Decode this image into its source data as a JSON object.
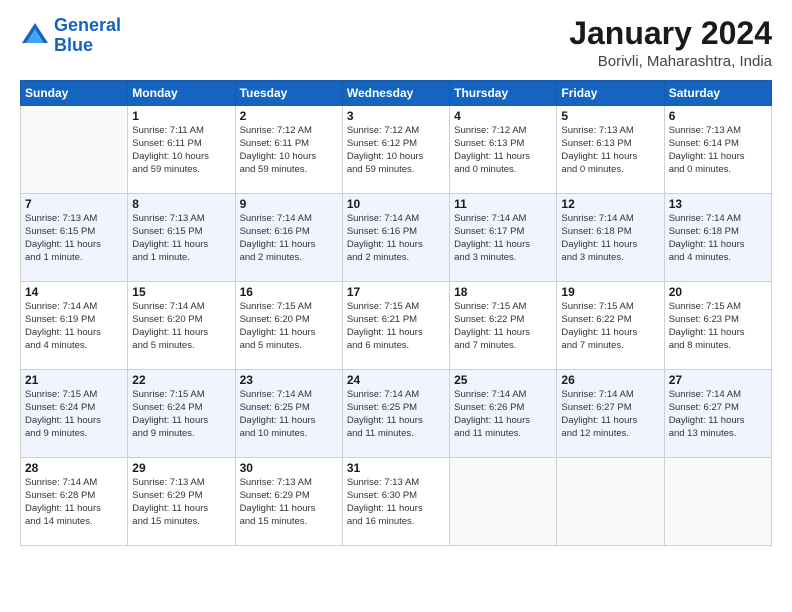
{
  "header": {
    "logo_line1": "General",
    "logo_line2": "Blue",
    "title": "January 2024",
    "subtitle": "Borivli, Maharashtra, India"
  },
  "days_of_week": [
    "Sunday",
    "Monday",
    "Tuesday",
    "Wednesday",
    "Thursday",
    "Friday",
    "Saturday"
  ],
  "weeks": [
    [
      {
        "day": "",
        "info": ""
      },
      {
        "day": "1",
        "info": "Sunrise: 7:11 AM\nSunset: 6:11 PM\nDaylight: 10 hours\nand 59 minutes."
      },
      {
        "day": "2",
        "info": "Sunrise: 7:12 AM\nSunset: 6:11 PM\nDaylight: 10 hours\nand 59 minutes."
      },
      {
        "day": "3",
        "info": "Sunrise: 7:12 AM\nSunset: 6:12 PM\nDaylight: 10 hours\nand 59 minutes."
      },
      {
        "day": "4",
        "info": "Sunrise: 7:12 AM\nSunset: 6:13 PM\nDaylight: 11 hours\nand 0 minutes."
      },
      {
        "day": "5",
        "info": "Sunrise: 7:13 AM\nSunset: 6:13 PM\nDaylight: 11 hours\nand 0 minutes."
      },
      {
        "day": "6",
        "info": "Sunrise: 7:13 AM\nSunset: 6:14 PM\nDaylight: 11 hours\nand 0 minutes."
      }
    ],
    [
      {
        "day": "7",
        "info": "Sunrise: 7:13 AM\nSunset: 6:15 PM\nDaylight: 11 hours\nand 1 minute."
      },
      {
        "day": "8",
        "info": "Sunrise: 7:13 AM\nSunset: 6:15 PM\nDaylight: 11 hours\nand 1 minute."
      },
      {
        "day": "9",
        "info": "Sunrise: 7:14 AM\nSunset: 6:16 PM\nDaylight: 11 hours\nand 2 minutes."
      },
      {
        "day": "10",
        "info": "Sunrise: 7:14 AM\nSunset: 6:16 PM\nDaylight: 11 hours\nand 2 minutes."
      },
      {
        "day": "11",
        "info": "Sunrise: 7:14 AM\nSunset: 6:17 PM\nDaylight: 11 hours\nand 3 minutes."
      },
      {
        "day": "12",
        "info": "Sunrise: 7:14 AM\nSunset: 6:18 PM\nDaylight: 11 hours\nand 3 minutes."
      },
      {
        "day": "13",
        "info": "Sunrise: 7:14 AM\nSunset: 6:18 PM\nDaylight: 11 hours\nand 4 minutes."
      }
    ],
    [
      {
        "day": "14",
        "info": "Sunrise: 7:14 AM\nSunset: 6:19 PM\nDaylight: 11 hours\nand 4 minutes."
      },
      {
        "day": "15",
        "info": "Sunrise: 7:14 AM\nSunset: 6:20 PM\nDaylight: 11 hours\nand 5 minutes."
      },
      {
        "day": "16",
        "info": "Sunrise: 7:15 AM\nSunset: 6:20 PM\nDaylight: 11 hours\nand 5 minutes."
      },
      {
        "day": "17",
        "info": "Sunrise: 7:15 AM\nSunset: 6:21 PM\nDaylight: 11 hours\nand 6 minutes."
      },
      {
        "day": "18",
        "info": "Sunrise: 7:15 AM\nSunset: 6:22 PM\nDaylight: 11 hours\nand 7 minutes."
      },
      {
        "day": "19",
        "info": "Sunrise: 7:15 AM\nSunset: 6:22 PM\nDaylight: 11 hours\nand 7 minutes."
      },
      {
        "day": "20",
        "info": "Sunrise: 7:15 AM\nSunset: 6:23 PM\nDaylight: 11 hours\nand 8 minutes."
      }
    ],
    [
      {
        "day": "21",
        "info": "Sunrise: 7:15 AM\nSunset: 6:24 PM\nDaylight: 11 hours\nand 9 minutes."
      },
      {
        "day": "22",
        "info": "Sunrise: 7:15 AM\nSunset: 6:24 PM\nDaylight: 11 hours\nand 9 minutes."
      },
      {
        "day": "23",
        "info": "Sunrise: 7:14 AM\nSunset: 6:25 PM\nDaylight: 11 hours\nand 10 minutes."
      },
      {
        "day": "24",
        "info": "Sunrise: 7:14 AM\nSunset: 6:25 PM\nDaylight: 11 hours\nand 11 minutes."
      },
      {
        "day": "25",
        "info": "Sunrise: 7:14 AM\nSunset: 6:26 PM\nDaylight: 11 hours\nand 11 minutes."
      },
      {
        "day": "26",
        "info": "Sunrise: 7:14 AM\nSunset: 6:27 PM\nDaylight: 11 hours\nand 12 minutes."
      },
      {
        "day": "27",
        "info": "Sunrise: 7:14 AM\nSunset: 6:27 PM\nDaylight: 11 hours\nand 13 minutes."
      }
    ],
    [
      {
        "day": "28",
        "info": "Sunrise: 7:14 AM\nSunset: 6:28 PM\nDaylight: 11 hours\nand 14 minutes."
      },
      {
        "day": "29",
        "info": "Sunrise: 7:13 AM\nSunset: 6:29 PM\nDaylight: 11 hours\nand 15 minutes."
      },
      {
        "day": "30",
        "info": "Sunrise: 7:13 AM\nSunset: 6:29 PM\nDaylight: 11 hours\nand 15 minutes."
      },
      {
        "day": "31",
        "info": "Sunrise: 7:13 AM\nSunset: 6:30 PM\nDaylight: 11 hours\nand 16 minutes."
      },
      {
        "day": "",
        "info": ""
      },
      {
        "day": "",
        "info": ""
      },
      {
        "day": "",
        "info": ""
      }
    ]
  ]
}
